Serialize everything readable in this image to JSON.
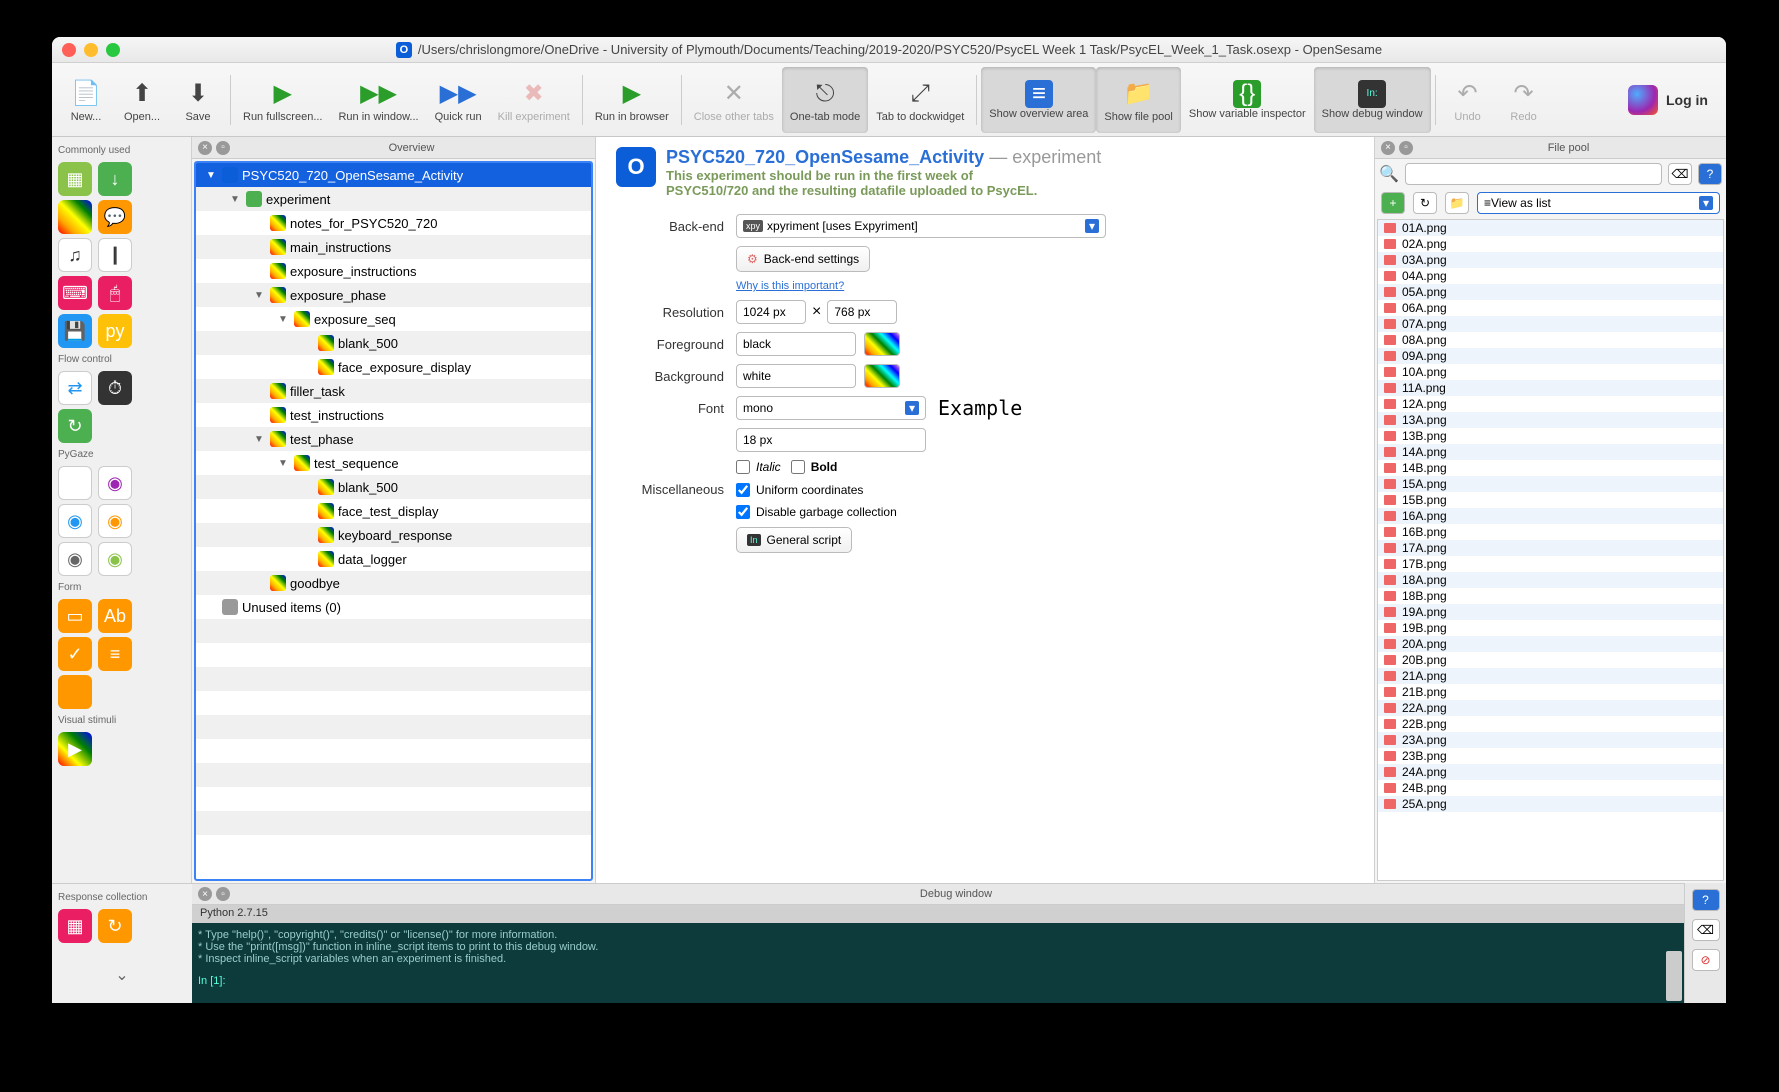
{
  "window": {
    "title": "/Users/chrislongmore/OneDrive - University of Plymouth/Documents/Teaching/2019-2020/PSYC520/PsycEL Week 1 Task/PsycEL_Week_1_Task.osexp - OpenSesame"
  },
  "toolbar": {
    "new": "New...",
    "open": "Open...",
    "save": "Save",
    "runfs": "Run fullscreen...",
    "runwin": "Run in window...",
    "quickrun": "Quick run",
    "kill": "Kill experiment",
    "runbrowser": "Run in browser",
    "closetabs": "Close other tabs",
    "onetab": "One-tab mode",
    "dock": "Tab to dockwidget",
    "overview": "Show overview area",
    "filepool": "Show file pool",
    "varinsp": "Show variable inspector",
    "debug": "Show debug window",
    "undo": "Undo",
    "redo": "Redo",
    "login": "Log in"
  },
  "sidebar": {
    "sections": [
      "Commonly used",
      "Flow control",
      "PyGaze",
      "Form",
      "Visual stimuli",
      "Response collection"
    ]
  },
  "overview": {
    "title": "Overview",
    "tree": [
      {
        "label": "PSYC520_720_OpenSesame_Activity",
        "depth": 0,
        "selected": true,
        "arrow": "▼"
      },
      {
        "label": "experiment",
        "depth": 1,
        "arrow": "▼"
      },
      {
        "label": "notes_for_PSYC520_720",
        "depth": 2
      },
      {
        "label": "main_instructions",
        "depth": 2
      },
      {
        "label": "exposure_instructions",
        "depth": 2
      },
      {
        "label": "exposure_phase",
        "depth": 2,
        "arrow": "▼"
      },
      {
        "label": "exposure_seq",
        "depth": 3,
        "arrow": "▼"
      },
      {
        "label": "blank_500",
        "depth": 4
      },
      {
        "label": "face_exposure_display",
        "depth": 4
      },
      {
        "label": "filler_task",
        "depth": 2
      },
      {
        "label": "test_instructions",
        "depth": 2
      },
      {
        "label": "test_phase",
        "depth": 2,
        "arrow": "▼"
      },
      {
        "label": "test_sequence",
        "depth": 3,
        "arrow": "▼"
      },
      {
        "label": "blank_500",
        "depth": 4
      },
      {
        "label": "face_test_display",
        "depth": 4
      },
      {
        "label": "keyboard_response",
        "depth": 4
      },
      {
        "label": "data_logger",
        "depth": 4
      },
      {
        "label": "goodbye",
        "depth": 2
      },
      {
        "label": "Unused items (0)",
        "depth": 0
      }
    ]
  },
  "content": {
    "title": "PSYC520_720_OpenSesame_Activity",
    "suffix": " — experiment",
    "desc": "This experiment should be run in the first week of PSYC510/720 and the resulting datafile uploaded to PsycEL.",
    "backend_label": "Back-end",
    "backend_value": "xpyriment [uses Expyriment]",
    "backend_settings": "Back-end settings",
    "why": "Why is this important?",
    "resolution_label": "Resolution",
    "res_w": "1024 px",
    "res_x": "×",
    "res_h": "768 px",
    "foreground_label": "Foreground",
    "foreground_value": "black",
    "background_label": "Background",
    "background_value": "white",
    "font_label": "Font",
    "font_value": "mono",
    "font_size": "18 px",
    "italic": "Italic",
    "bold": "Bold",
    "example": "Example",
    "misc_label": "Miscellaneous",
    "uniform": "Uniform coordinates",
    "gc": "Disable garbage collection",
    "gscript": "General script"
  },
  "filepool": {
    "title": "File pool",
    "view": "View as list",
    "files": [
      "01A.png",
      "02A.png",
      "03A.png",
      "04A.png",
      "05A.png",
      "06A.png",
      "07A.png",
      "08A.png",
      "09A.png",
      "10A.png",
      "11A.png",
      "12A.png",
      "13A.png",
      "13B.png",
      "14A.png",
      "14B.png",
      "15A.png",
      "15B.png",
      "16A.png",
      "16B.png",
      "17A.png",
      "17B.png",
      "18A.png",
      "18B.png",
      "19A.png",
      "19B.png",
      "20A.png",
      "20B.png",
      "21A.png",
      "21B.png",
      "22A.png",
      "22B.png",
      "23A.png",
      "23B.png",
      "24A.png",
      "24B.png",
      "25A.png"
    ]
  },
  "debug": {
    "title": "Debug window",
    "status": "Python 2.7.15",
    "line1": "* Type \"help()\", \"copyright()\", \"credits()\" or \"license()\" for more information.",
    "line2": "* Use the \"print([msg])\" function in inline_script items to print to this debug window.",
    "line3": "* Inspect inline_script variables when an experiment is finished.",
    "prompt": "In [1]:"
  }
}
